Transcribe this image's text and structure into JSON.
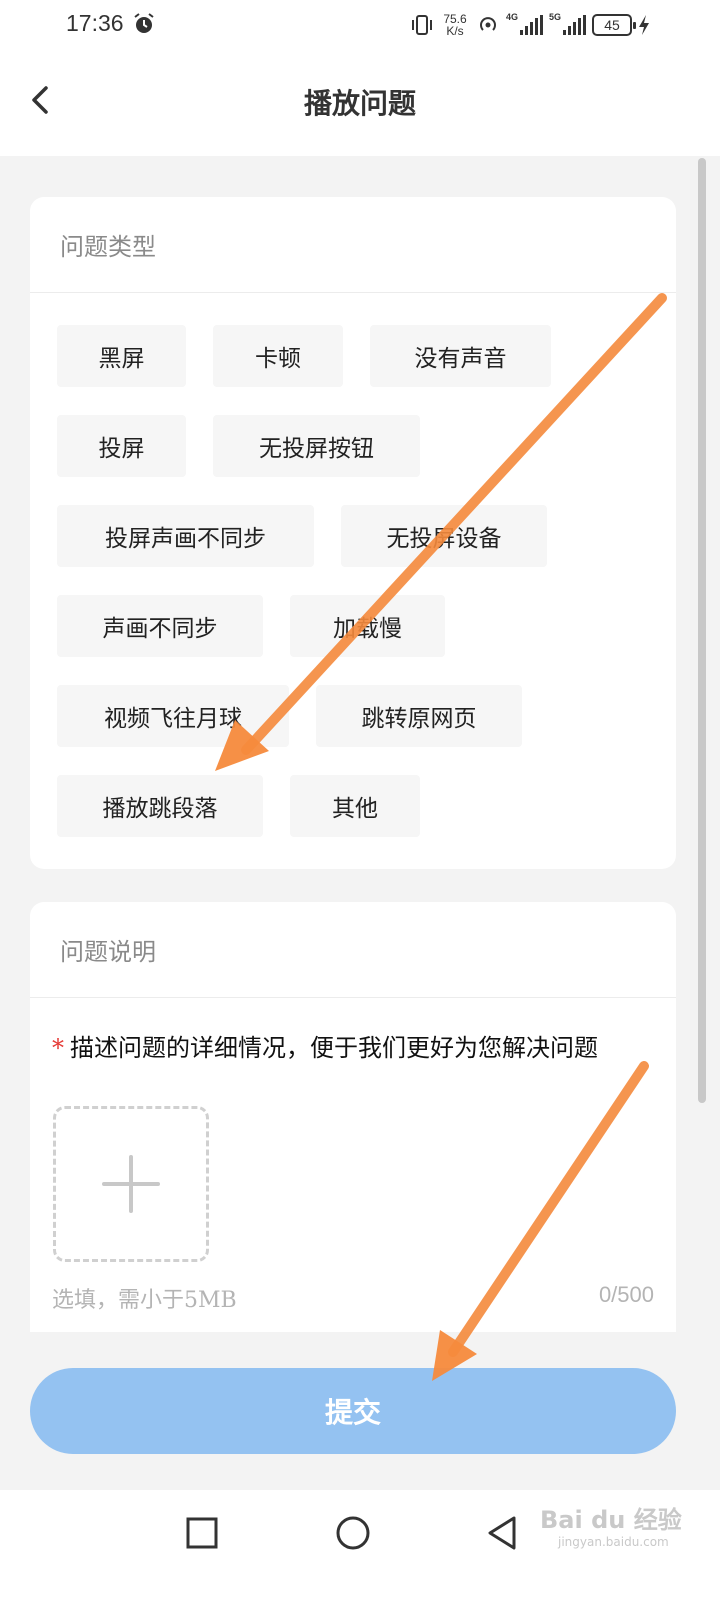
{
  "status_bar": {
    "time": "17:36",
    "net_speed_value": "75.6",
    "net_speed_unit": "K/s",
    "sim1_tech": "4G",
    "sim2_tech": "5G",
    "battery": "45"
  },
  "header": {
    "title": "播放问题"
  },
  "problem_type": {
    "label": "问题类型",
    "options": [
      "黑屏",
      "卡顿",
      "没有声音",
      "投屏",
      "无投屏按钮",
      "投屏声画不同步",
      "无投屏设备",
      "声画不同步",
      "加载慢",
      "视频飞往月球",
      "跳转原网页",
      "播放跳段落",
      "其他"
    ]
  },
  "problem_desc": {
    "label": "问题说明",
    "required_mark": "*",
    "placeholder": "描述问题的详细情况，便于我们更好为您解决问题",
    "upload_hint": "选填，需小于5MB",
    "char_count": "0/500"
  },
  "submit_label": "提交",
  "colors": {
    "accent": "#94c2f1",
    "annotation_arrow": "#f58a3c",
    "required": "#e53935"
  },
  "watermark": {
    "brand": "Bai du 经验",
    "url": "jingyan.baidu.com"
  }
}
